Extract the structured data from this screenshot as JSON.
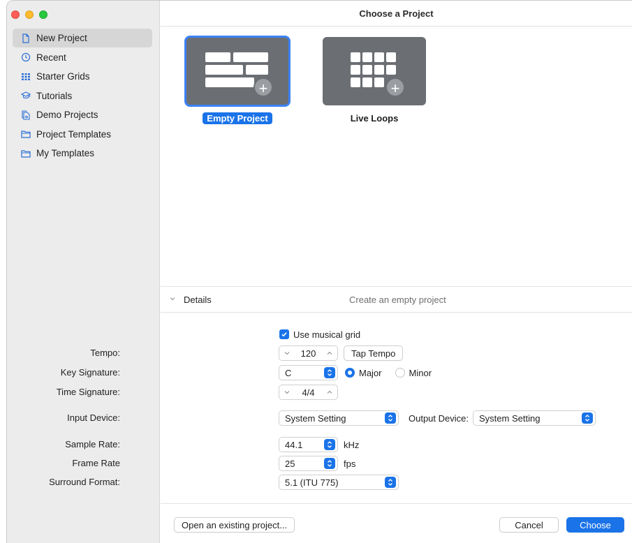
{
  "window": {
    "title": "Choose a Project"
  },
  "sidebar": {
    "items": [
      {
        "label": "New Project",
        "icon": "document-icon"
      },
      {
        "label": "Recent",
        "icon": "clock-icon"
      },
      {
        "label": "Starter Grids",
        "icon": "grid-icon"
      },
      {
        "label": "Tutorials",
        "icon": "graduation-cap-icon"
      },
      {
        "label": "Demo Projects",
        "icon": "documents-icon"
      },
      {
        "label": "Project Templates",
        "icon": "folder-icon"
      },
      {
        "label": "My Templates",
        "icon": "folder-icon"
      }
    ],
    "selected": "New Project"
  },
  "tiles": [
    {
      "label": "Empty Project",
      "selected": true
    },
    {
      "label": "Live Loops",
      "selected": false
    }
  ],
  "details": {
    "label": "Details",
    "description": "Create an empty project"
  },
  "form": {
    "use_grid_label": "Use musical grid",
    "use_grid_checked": true,
    "tempo_label": "Tempo:",
    "tempo_value": "120",
    "tap_tempo_label": "Tap Tempo",
    "key_signature_label": "Key Signature:",
    "key_signature_value": "C",
    "major_label": "Major",
    "minor_label": "Minor",
    "mode_selected": "Major",
    "time_signature_label": "Time Signature:",
    "time_signature_value": "4/4",
    "input_device_label": "Input Device:",
    "input_device_value": "System Setting",
    "output_device_label": "Output Device:",
    "output_device_value": "System Setting",
    "sample_rate_label": "Sample Rate:",
    "sample_rate_value": "44.1",
    "sample_rate_unit": "kHz",
    "frame_rate_label": "Frame Rate",
    "frame_rate_value": "25",
    "frame_rate_unit": "fps",
    "surround_label": "Surround Format:",
    "surround_value": "5.1 (ITU 775)"
  },
  "footer": {
    "open_existing_label": "Open an existing project...",
    "cancel_label": "Cancel",
    "choose_label": "Choose"
  },
  "colors": {
    "accent": "#1a73e8",
    "sidebar_bg": "#ececec",
    "tile_bg": "#6b6e72"
  }
}
